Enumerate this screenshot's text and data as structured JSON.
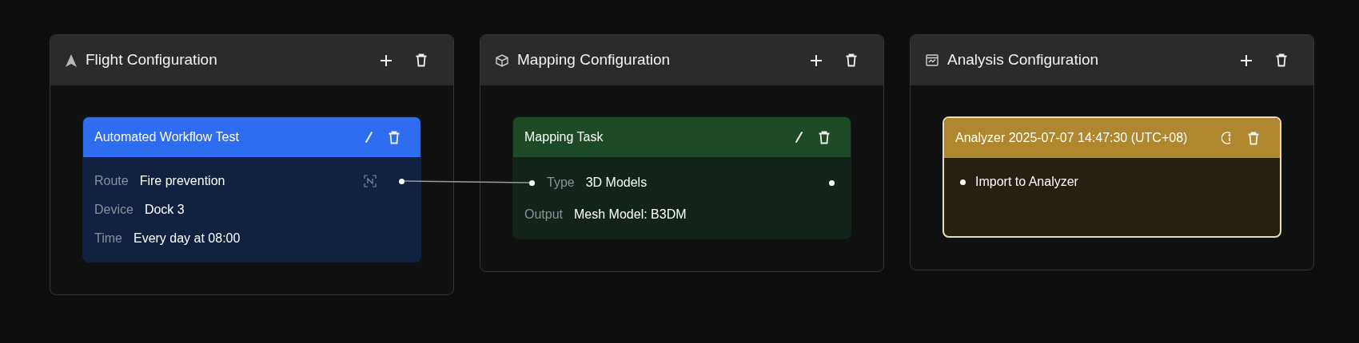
{
  "panels": [
    {
      "kind": "flight",
      "title": "Flight Configuration",
      "card": {
        "title": "Automated Workflow Test",
        "color": "#2f6df0",
        "selected": false,
        "kind": "fields",
        "fields": [
          {
            "kind": "route",
            "label": "Route",
            "value": "Fire prevention",
            "in_port": false,
            "out_port": true
          },
          {
            "kind": "plain",
            "label": "Device",
            "value": "Dock 3",
            "in_port": false,
            "out_port": false
          },
          {
            "kind": "plain",
            "label": "Time",
            "value": "Every day at 08:00",
            "in_port": false,
            "out_port": false
          }
        ]
      }
    },
    {
      "kind": "mapping",
      "title": "Mapping Configuration",
      "card": {
        "title": "Mapping Task",
        "color": "#1d4a27",
        "selected": false,
        "kind": "fields",
        "fields": [
          {
            "kind": "plain",
            "label": "Type",
            "value": "3D Models",
            "in_port": true,
            "out_port": true
          },
          {
            "kind": "plain",
            "label": "Output",
            "value": "Mesh Model: B3DM",
            "in_port": false,
            "out_port": false
          }
        ]
      }
    },
    {
      "kind": "analysis",
      "title": "Analysis Configuration",
      "card": {
        "title": "Analyzer 2025-07-07 14:47:30 (UTC+08)",
        "color": "#b0862e",
        "selected": true,
        "kind": "list",
        "items": [
          "Import to Analyzer"
        ]
      }
    }
  ]
}
